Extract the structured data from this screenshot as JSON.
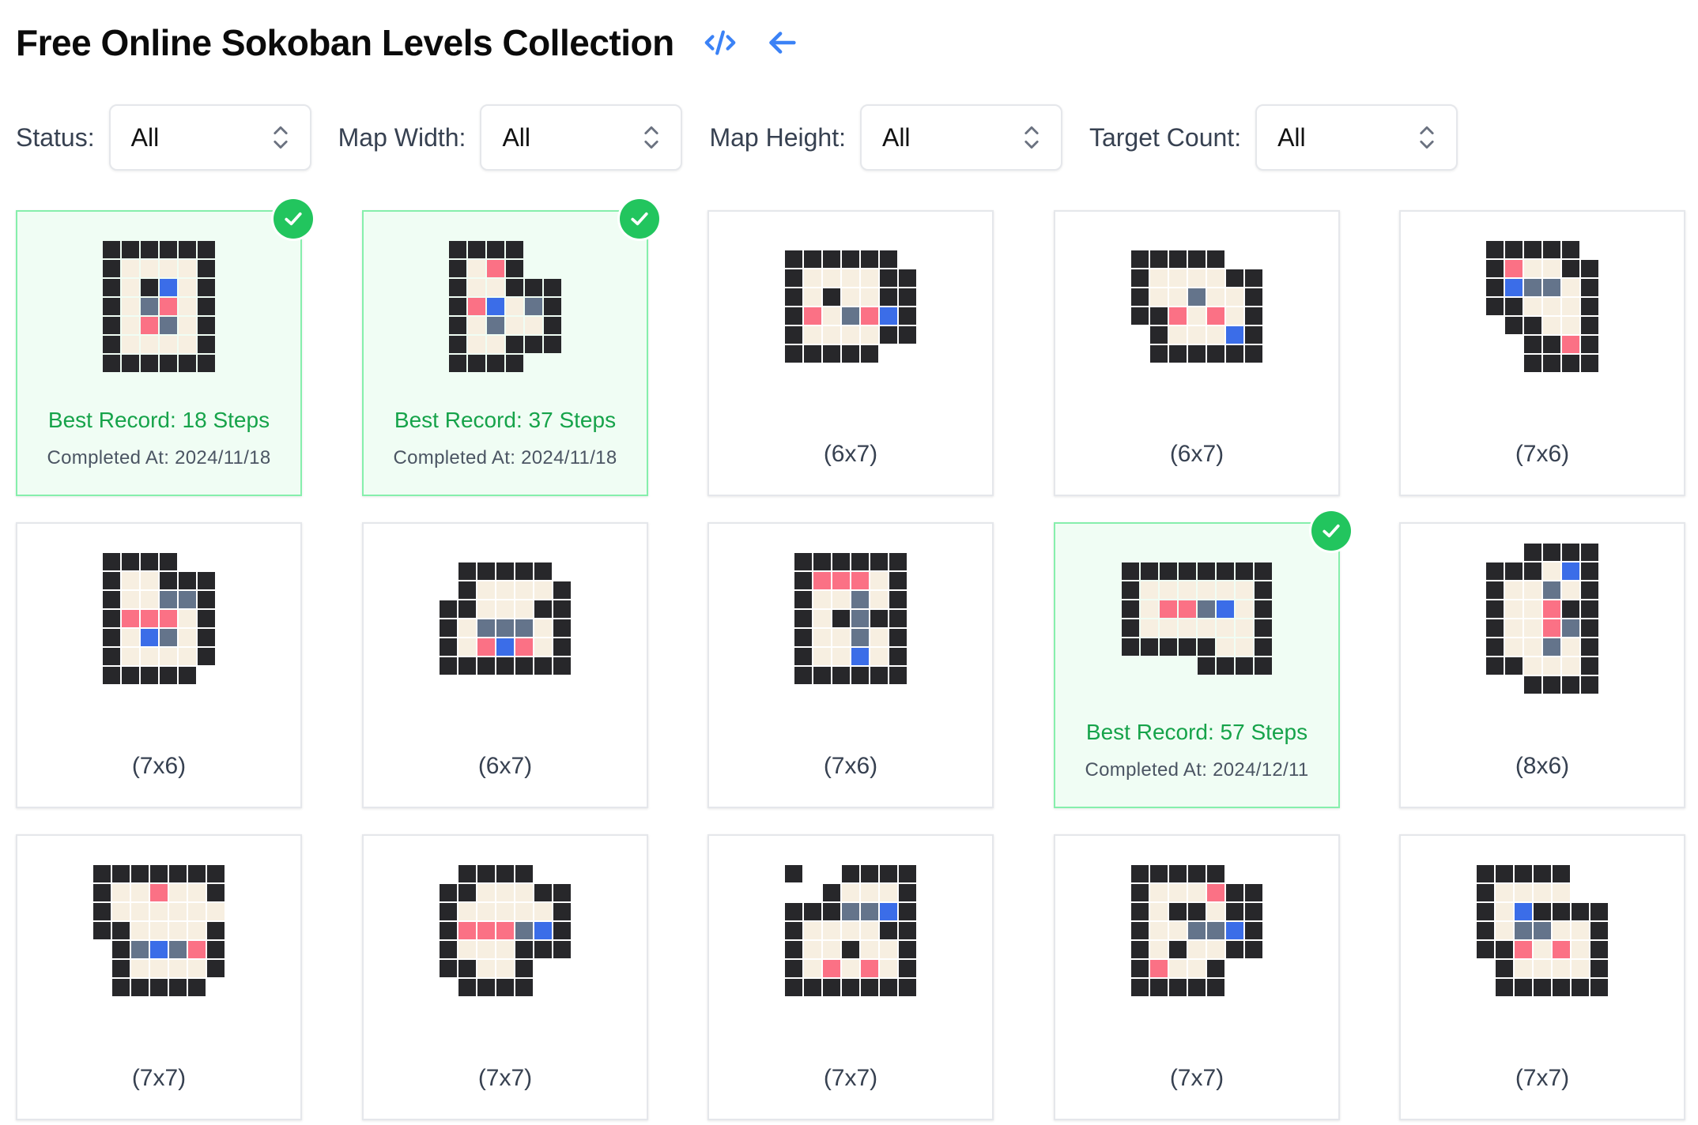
{
  "header": {
    "title": "Free Online Sokoban Levels Collection",
    "code_icon": "code-icon",
    "back_icon": "arrow-left-icon"
  },
  "filters": [
    {
      "label": "Status:",
      "value": "All"
    },
    {
      "label": "Map Width:",
      "value": "All"
    },
    {
      "label": "Map Height:",
      "value": "All"
    },
    {
      "label": "Target Count:",
      "value": "All"
    }
  ],
  "colors": {
    "wall": "#27272a",
    "floor": "#f7efe1",
    "target": "#fb7185",
    "box": "#64748b",
    "player": "#3b6de8",
    "completed_green": "#16a34a",
    "check_badge": "#22c55e",
    "accent_blue": "#3b82f6"
  },
  "legend_codes": {
    "e": "empty",
    "w": "wall",
    "f": "floor",
    "t": "target",
    "b": "box",
    "p": "player"
  },
  "levels": [
    {
      "size": "",
      "completed": true,
      "record": "Best Record: 18 Steps",
      "date": "Completed At: 2024/11/18",
      "map": [
        "wwwwww",
        "wffffw",
        "wfwpfw",
        "wfbtfw",
        "wftbfw",
        "wffffw",
        "wwwwww"
      ]
    },
    {
      "size": "",
      "completed": true,
      "record": "Best Record: 37 Steps",
      "date": "Completed At: 2024/11/18",
      "map": [
        "wwwwee",
        "wftwee",
        "wffwww",
        "wtpfbw",
        "wfbffw",
        "wffwww",
        "wwwwee"
      ]
    },
    {
      "size": "(6x7)",
      "completed": false,
      "record": "",
      "date": "",
      "map": [
        "wwwwwwe",
        "wffffww",
        "wfwffww",
        "wtfbtpw",
        "wffffww",
        "wwwwwee"
      ]
    },
    {
      "size": "(6x7)",
      "completed": false,
      "record": "",
      "date": "",
      "map": [
        "wwwwwee",
        "wffffww",
        "wffbffw",
        "wwtftfw",
        "ewfffpw",
        "ewwwwww"
      ]
    },
    {
      "size": "(7x6)",
      "completed": false,
      "record": "",
      "date": "",
      "map": [
        "wwwwwe",
        "wtffww",
        "wpbbfw",
        "wwfffw",
        "ewwffw",
        "eewwtw",
        "eewwww"
      ]
    },
    {
      "size": "(7x6)",
      "completed": false,
      "record": "",
      "date": "",
      "map": [
        "wwwwee",
        "wffwww",
        "wffbbw",
        "wtttfw",
        "wfpbfw",
        "wffffw",
        "wwwwwe"
      ]
    },
    {
      "size": "(6x7)",
      "completed": false,
      "record": "",
      "date": "",
      "map": [
        "ewwwwwe",
        "ewffffw",
        "wwfffww",
        "wfbbbfw",
        "wftptfw",
        "wwwwwww"
      ]
    },
    {
      "size": "(7x6)",
      "completed": false,
      "record": "",
      "date": "",
      "map": [
        "wwwwww",
        "wtttfw",
        "wffbfw",
        "wfwbww",
        "wffbfw",
        "wffpfw",
        "wwwwww"
      ]
    },
    {
      "size": "",
      "completed": true,
      "record": "Best Record: 57 Steps",
      "date": "Completed At: 2024/12/11",
      "map": [
        "wwwwwwww",
        "wffffffw",
        "wfttbpfw",
        "wffffffw",
        "wwwwwffw",
        "eeeewwww"
      ]
    },
    {
      "size": "(8x6)",
      "completed": false,
      "record": "",
      "date": "",
      "map": [
        "eewwww",
        "wwwfpw",
        "wffbfw",
        "wfftww",
        "wfftbw",
        "wffbfw",
        "wwfffw",
        "eewwww"
      ]
    },
    {
      "size": "(7x7)",
      "completed": false,
      "record": "",
      "date": "",
      "map": [
        "wwwwwww",
        "wfftffw",
        "wffffff",
        "wwffffw",
        "ewbpbtw",
        "ewffffw",
        "ewwwwwe"
      ]
    },
    {
      "size": "(7x7)",
      "completed": false,
      "record": "",
      "date": "",
      "map": [
        "ewwwwee",
        "wwfffww",
        "wfffffw",
        "wtttbpw",
        "wfffwww",
        "wwffwee",
        "ewwwwee"
      ]
    },
    {
      "size": "(7x7)",
      "completed": false,
      "record": "",
      "date": "",
      "map": [
        "weewwww",
        "eewfffw",
        "wwwbbpw",
        "wffffww",
        "wffwffw",
        "wftftfw",
        "wwwwwww"
      ]
    },
    {
      "size": "(7x7)",
      "completed": false,
      "record": "",
      "date": "",
      "map": [
        "wwwwwee",
        "wffftww",
        "wfwwfww",
        "wffbbpw",
        "wfwffww",
        "wtffwee",
        "wwwwwee"
      ]
    },
    {
      "size": "(7x7)",
      "completed": false,
      "record": "",
      "date": "",
      "map": [
        "wwwwwee",
        "wffffee",
        "wfpwwww",
        "wfbbffw",
        "wwtftfw",
        "ewffffw",
        "ewwwwww"
      ]
    }
  ]
}
